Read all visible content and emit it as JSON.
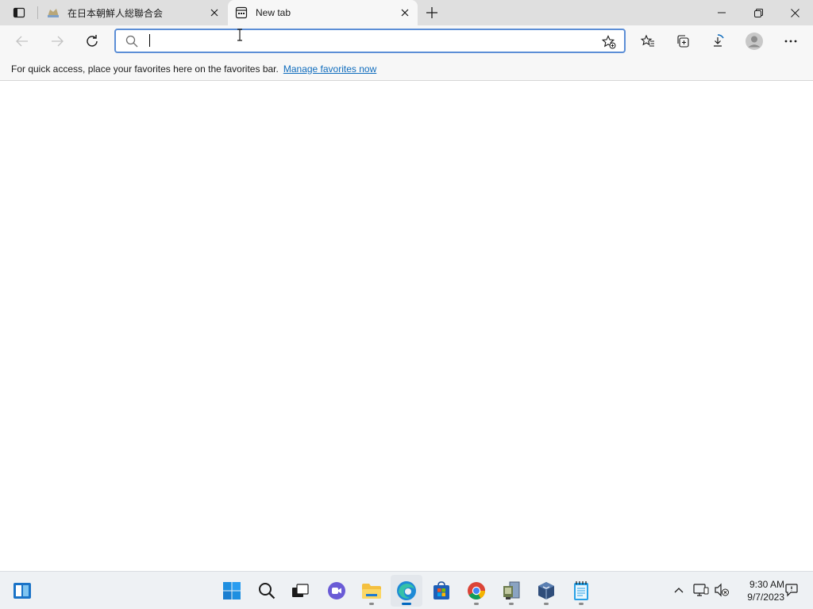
{
  "tabs": [
    {
      "title": "在日本朝鮮人総聯合会",
      "active": false
    },
    {
      "title": "New tab",
      "active": true
    }
  ],
  "address_bar": {
    "value": "",
    "placeholder": ""
  },
  "favorites_bar": {
    "message": "For quick access, place your favorites here on the favorites bar.",
    "link": "Manage favorites now"
  },
  "taskbar": {
    "apps": [
      "start-icon",
      "search-icon",
      "task-view-icon",
      "chat-icon",
      "file-explorer-icon",
      "edge-icon",
      "store-icon",
      "chrome-icon",
      "app-icon",
      "virtualbox-icon",
      "notepad-icon"
    ],
    "clock": {
      "time": "9:30 AM",
      "date": "9/7/2023"
    }
  },
  "colors": {
    "accent": "#0f6cbd",
    "address_border": "#5c8ed6",
    "tabstrip": "#dfdfdf",
    "toolbar": "#f7f7f7"
  }
}
